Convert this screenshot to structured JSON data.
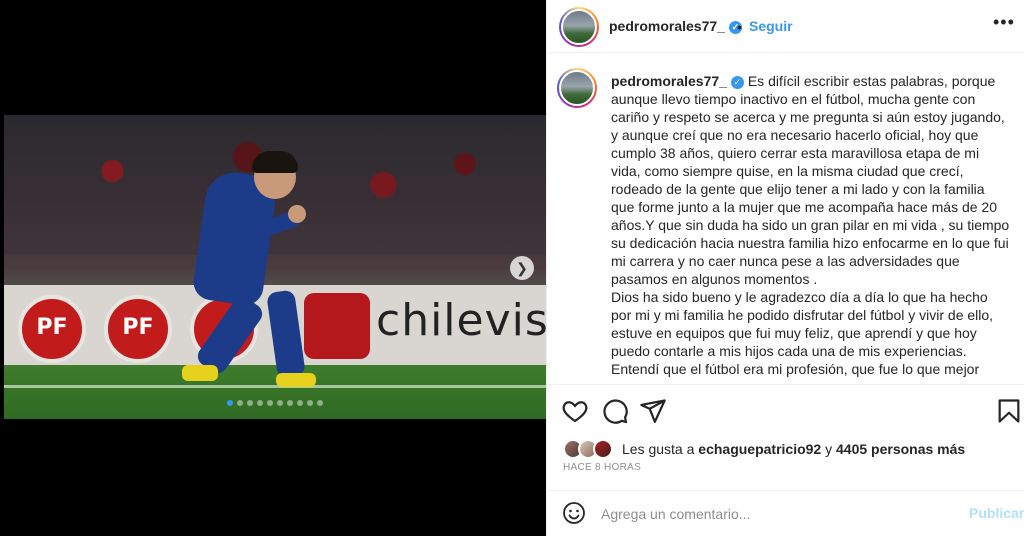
{
  "post": {
    "username": "pedromorales77_",
    "verified": true,
    "follow_label": "Seguir",
    "bullet": "•",
    "more_label": "•••",
    "caption": "Es difícil escribir estas palabras, porque aunque llevo tiempo inactivo en el fútbol, mucha gente con cariño y respeto se acerca y me pregunta si aún estoy jugando, y aunque creí que no era necesario hacerlo oficial, hoy que cumplo 38 años, quiero cerrar esta maravillosa etapa de mi vida, como siempre quise, en la misma ciudad que crecí, rodeado de la gente que elijo tener a mi lado y con la familia que forme junto a la mujer que me acompaña hace más de 20 años.Y que sin duda ha sido un gran pilar en mi vida , su tiempo su dedicación hacia nuestra familia hizo enfocarme en lo que fui mi carrera y no caer nunca pese a las adversidades que pasamos en algunos momentos .\nDios ha sido bueno y le agradezco día a día lo que ha hecho por mi y mi familia he podido disfrutar del fútbol y vivir de ello, estuve en equipos que fui muy feliz, que aprendí y que hoy puedo contarle a mis hijos cada una de mis experiencias.\nEntendí que el fútbol era mi profesión, que fue lo que mejor"
  },
  "media": {
    "ad_text": "chilevis",
    "pf_label": "PF",
    "next_icon": "chevron-right-icon",
    "carousel_count": 10,
    "carousel_active": 0
  },
  "likes": {
    "prefix": "Les gusta a ",
    "user": "echaguepatricio92",
    "middle": " y ",
    "count": "4405 personas más"
  },
  "time_label": "HACE 8 HORAS",
  "comment": {
    "placeholder": "Agrega un comentario...",
    "publish_label": "Publicar"
  },
  "colors": {
    "accent": "#3897f0",
    "publish_disabled": "#b2dffc",
    "text": "#262626",
    "muted": "#8e8e8e"
  }
}
